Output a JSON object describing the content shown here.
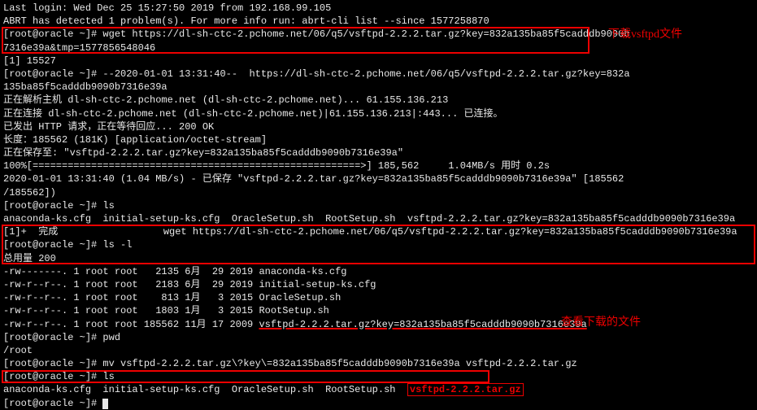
{
  "lines": {
    "l1": "Last login: Wed Dec 25 15:27:50 2019 from 192.168.99.105",
    "l2": "ABRT has detected 1 problem(s). For more info run: abrt-cli list --since 1577258870",
    "l3a": "[root@oracle ~]# wget https://dl-sh-ctc-2.pchome.net/06/q5/vsftpd-2.2.2.tar.gz?key=832a135ba85f5cadddb9090b",
    "l3b": "7316e39a&tmp=1577856548046",
    "l4": "[1] 15527",
    "l5": "[root@oracle ~]# --2020-01-01 13:31:40--  https://dl-sh-ctc-2.pchome.net/06/q5/vsftpd-2.2.2.tar.gz?key=832a",
    "l6": "135ba85f5cadddb9090b7316e39a",
    "l7": "正在解析主机 dl-sh-ctc-2.pchome.net (dl-sh-ctc-2.pchome.net)... 61.155.136.213",
    "l8": "正在连接 dl-sh-ctc-2.pchome.net (dl-sh-ctc-2.pchome.net)|61.155.136.213|:443... 已连接。",
    "l9": "已发出 HTTP 请求，正在等待回应... 200 OK",
    "l10": "长度：185562 (181K) [application/octet-stream]",
    "l11": "正在保存至: \"vsftpd-2.2.2.tar.gz?key=832a135ba85f5cadddb9090b7316e39a\"",
    "l12": "",
    "l13": "100%[========================================================>] 185,562     1.04MB/s 用时 0.2s",
    "l14": "",
    "l15": "2020-01-01 13:31:40 (1.04 MB/s) - 已保存 \"vsftpd-2.2.2.tar.gz?key=832a135ba85f5cadddb9090b7316e39a\" [185562",
    "l16": "/185562])",
    "l17": "",
    "l18": "[root@oracle ~]# ls",
    "l19": "anaconda-ks.cfg  initial-setup-ks.cfg  OracleSetup.sh  RootSetup.sh  vsftpd-2.2.2.tar.gz?key=832a135ba85f5cadddb9090b7316e39a",
    "l20": "[1]+  完成                  wget https://dl-sh-ctc-2.pchome.net/06/q5/vsftpd-2.2.2.tar.gz?key=832a135ba85f5cadddb9090b7316e39a",
    "l21": "[root@oracle ~]# ls -l",
    "l22": "总用量 200",
    "l23": "-rw-------. 1 root root   2135 6月  29 2019 anaconda-ks.cfg",
    "l24": "-rw-r--r--. 1 root root   2183 6月  29 2019 initial-setup-ks.cfg",
    "l25": "-rw-r--r--. 1 root root    813 1月   3 2015 OracleSetup.sh",
    "l26": "-rw-r--r--. 1 root root   1803 1月   3 2015 RootSetup.sh",
    "l27a": "-rw-r--r--. 1 root root 185562 11月 17 2009 ",
    "l27b": "vsftpd-2.2.2.tar.gz?key=832a135ba85f5cadddb9090b7316e39a",
    "l28": "[root@oracle ~]# pwd",
    "l29": "/root",
    "l30": "[root@oracle ~]# mv vsftpd-2.2.2.tar.gz\\?key\\=832a135ba85f5cadddb9090b7316e39a vsftpd-2.2.2.tar.gz",
    "l31": "[root@oracle ~]# ls",
    "l32a": "anaconda-ks.cfg  initial-setup-ks.cfg  OracleSetup.sh  RootSetup.sh  ",
    "l32b": "vsftpd-2.2.2.tar.gz",
    "l33": "[root@oracle ~]# "
  },
  "annotations": {
    "a1": "下载vsftpd文件",
    "a2": "查看下载的文件"
  }
}
